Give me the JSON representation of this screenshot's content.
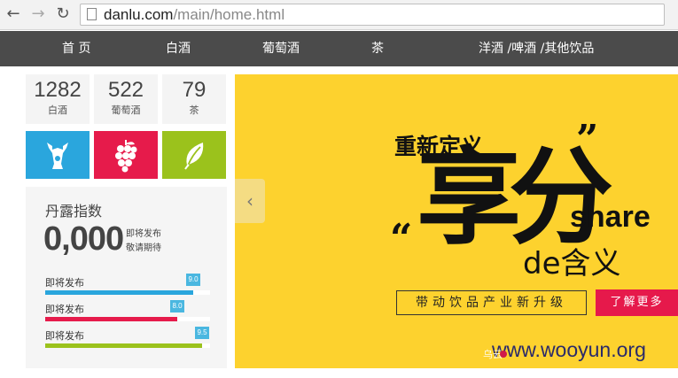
{
  "browser": {
    "url_domain": "danlu.com",
    "url_path": "/main/home.html",
    "back_icon": "back-arrow-icon",
    "forward_icon": "forward-arrow-icon",
    "reload_icon": "reload-icon",
    "page_icon": "page-icon"
  },
  "nav": {
    "items": [
      {
        "label": "首 页"
      },
      {
        "label": "白酒"
      },
      {
        "label": "葡萄酒"
      },
      {
        "label": "茶"
      },
      {
        "label": "洋酒 /啤酒 /其他饮品"
      }
    ]
  },
  "stats": [
    {
      "count": "1282",
      "label": "白酒"
    },
    {
      "count": "522",
      "label": "葡萄酒"
    },
    {
      "count": "79",
      "label": "茶"
    }
  ],
  "tiles": [
    {
      "icon": "baijiu-icon",
      "color": "#2aa6dd"
    },
    {
      "icon": "grape-icon",
      "color": "#e61b4b"
    },
    {
      "icon": "tea-leaf-icon",
      "color": "#9bc21c"
    }
  ],
  "index": {
    "title": "丹露指数",
    "value": "0,000",
    "note1": "即将发布",
    "note2": "敬请期待",
    "bars": [
      {
        "label": "即将发布",
        "score": "9.0",
        "fraction": 0.9,
        "color": "#2aa6dd"
      },
      {
        "label": "即将发布",
        "score": "8.0",
        "fraction": 0.8,
        "color": "#e61b4b"
      },
      {
        "label": "即将发布",
        "score": "9.5",
        "fraction": 0.95,
        "color": "#9bc21c"
      }
    ]
  },
  "banner": {
    "prev_icon": "chevron-left-icon",
    "line1": "重新定义",
    "quote_close": "”",
    "big": "享分",
    "share": "share",
    "quote_open": "“",
    "line2": "de含义",
    "slogan": "带动饮品产业新升级",
    "more_label": "了解更多",
    "background": "#fdd22e",
    "accent": "#e6194b"
  },
  "watermark": {
    "text": "www.wooyun.org",
    "small": "乌云"
  }
}
